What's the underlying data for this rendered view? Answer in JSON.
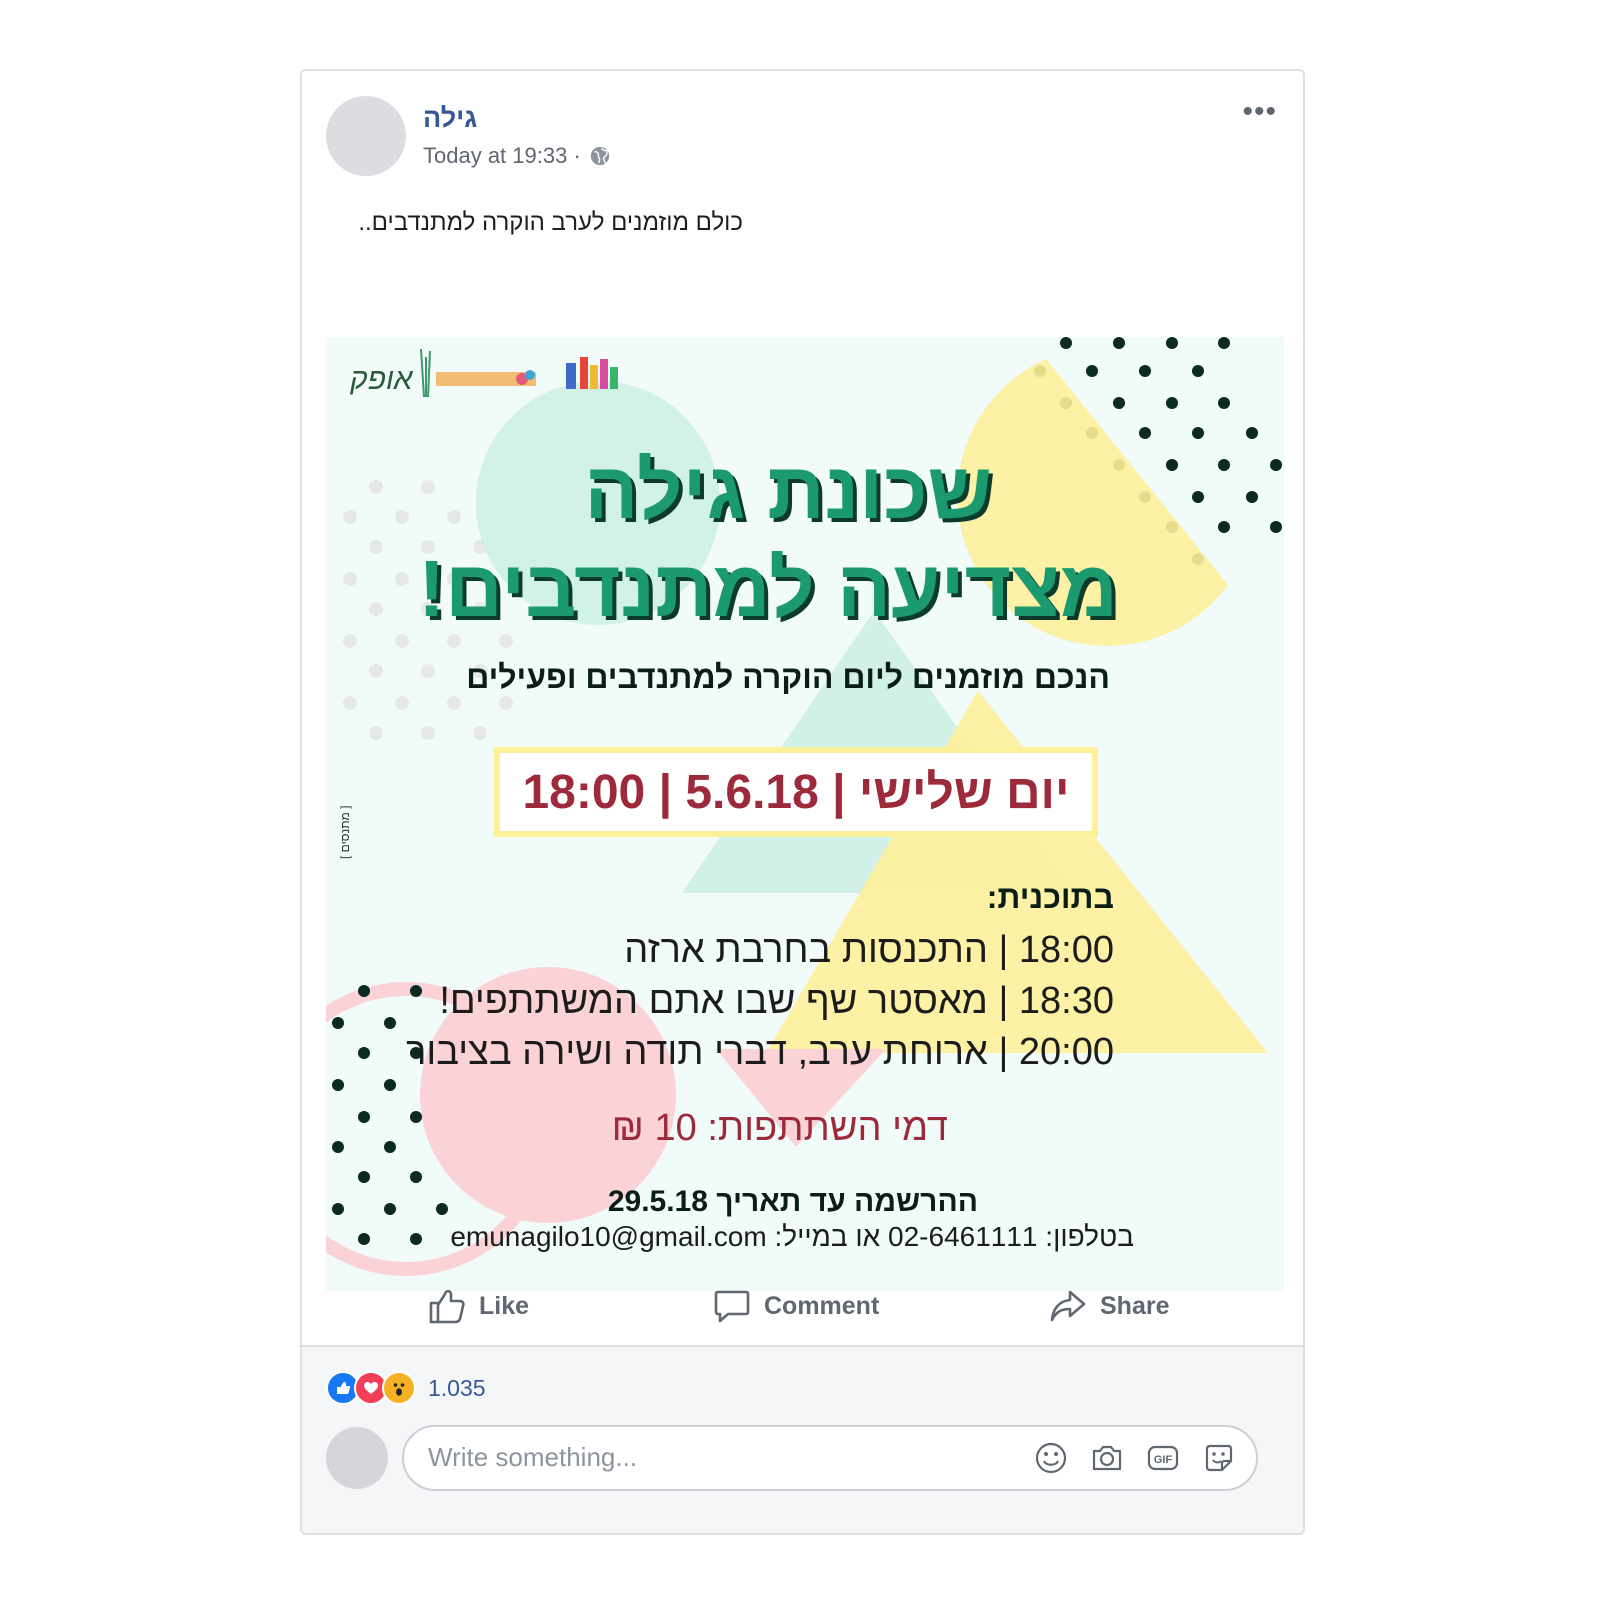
{
  "post": {
    "author": "גילה",
    "timestamp": "Today at 19:33 ·",
    "menu": "•••",
    "text": "כולם מוזמנים לערב הוקרה למתנדבים.."
  },
  "poster": {
    "title_line1": "שכונת גילה",
    "title_line2": "מצדיעה למתנדבים!",
    "subtitle": "הנכם מוזמנים ליום הוקרה למתנדבים ופעילים",
    "date_line": "יום שלישי | 5.6.18 | 18:00",
    "program_title": "בתוכנית:",
    "program": [
      "18:00 | התכנסות בחרבת ארזה",
      "18:30 | מאסטר שף שבו אתם המשתתפים!",
      "20:00 | ארוחת ערב, דברי תודה ושירה בציבור"
    ],
    "fee": "דמי השתתפות: 10 ₪",
    "registration": "ההרשמה עד תאריך 29.5.18",
    "contact": "בטלפון: 02-6461111 או במייל: emunagilo10@gmail.com",
    "vertical_tag": "[ מתנסים ]",
    "logo_text": "אופק",
    "colors": {
      "green": "#1a9a6e",
      "red": "#9c2a3b",
      "yellow": "#fdf09a",
      "mint": "#cdeee4",
      "pink": "#fbd3d7"
    }
  },
  "actions": {
    "like": "Like",
    "comment": "Comment",
    "share": "Share"
  },
  "reactions": {
    "count": "1.035",
    "icons": [
      "like-reaction-icon",
      "love-reaction-icon",
      "wow-reaction-icon"
    ]
  },
  "comment": {
    "placeholder": "Write something..."
  }
}
